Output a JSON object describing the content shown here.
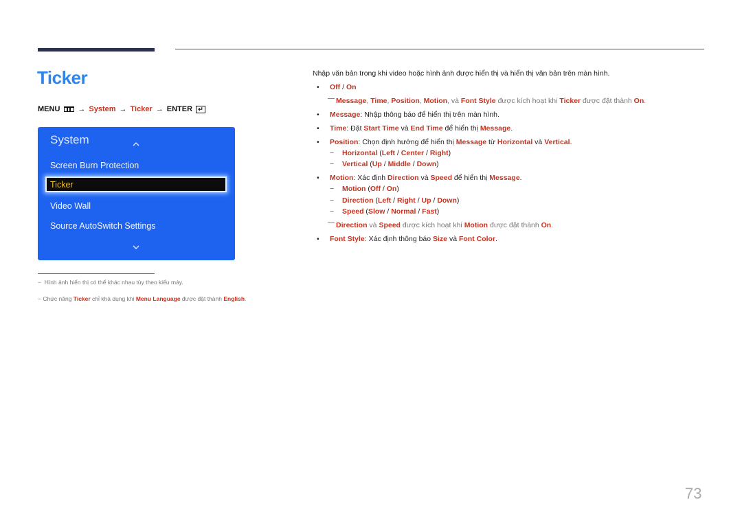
{
  "header": {
    "title": "Ticker",
    "menu_path": {
      "menu_label": "MENU",
      "step1": "System",
      "step2": "Ticker",
      "enter_label": "ENTER",
      "arrow": "→"
    }
  },
  "osd_panel": {
    "title": "System",
    "items": [
      {
        "label": "Screen Burn Protection",
        "selected": false
      },
      {
        "label": "Ticker",
        "selected": true
      },
      {
        "label": "Video Wall",
        "selected": false
      },
      {
        "label": "Source AutoSwitch Settings",
        "selected": false
      }
    ]
  },
  "footnotes": [
    {
      "text": "Hình ảnh hiển thị có thể khác nhau tùy theo kiểu máy."
    },
    {
      "pre": "Chức năng ",
      "k1": "Ticker",
      "mid": " chỉ khả dụng khi ",
      "k2": "Menu Language",
      "mid2": " được đặt thành ",
      "k3": "English",
      "end": "."
    }
  ],
  "content": {
    "intro": "Nhập văn bản trong khi video hoặc hình ảnh được hiển thị và hiển thị văn bản trên màn hình.",
    "off_on": {
      "off": "Off",
      "sep": " / ",
      "on": "On"
    },
    "note1": {
      "k1": "Message",
      "c1": ", ",
      "k2": "Time",
      "c2": ", ",
      "k3": "Position",
      "c3": ", ",
      "k4": "Motion",
      "c4": ", và ",
      "k5": "Font Style",
      "t1": " được kích hoạt khi ",
      "k6": "Ticker",
      "t2": " được đặt thành ",
      "k7": "On",
      "end": "."
    },
    "message": {
      "key": "Message",
      "text": ": Nhập thông báo để hiển thị trên màn hình."
    },
    "time": {
      "key": "Time",
      "t1": ": Đặt ",
      "k1": "Start Time",
      "t2": " và ",
      "k2": "End Time",
      "t3": " để hiển thị ",
      "k3": "Message",
      "end": "."
    },
    "position": {
      "key": "Position",
      "t1": ": Chọn định hướng để hiển thị ",
      "k1": "Message",
      "t2": " từ ",
      "k2": "Horizontal",
      "t3": " và ",
      "k3": "Vertical",
      "end": "."
    },
    "horizontal": {
      "key": "Horizontal",
      "o1": "Left",
      "o2": "Center",
      "o3": "Right"
    },
    "vertical": {
      "key": "Vertical",
      "o1": "Up",
      "o2": "Middle",
      "o3": "Down"
    },
    "motion": {
      "key": "Motion",
      "t1": ": Xác định ",
      "k1": "Direction",
      "t2": " và ",
      "k2": "Speed",
      "t3": " để hiển thị ",
      "k3": "Message",
      "end": "."
    },
    "motion_sub": {
      "key": "Motion",
      "o1": "Off",
      "o2": "On"
    },
    "direction_sub": {
      "key": "Direction",
      "o1": "Left",
      "o2": "Right",
      "o3": "Up",
      "o4": "Down"
    },
    "speed_sub": {
      "key": "Speed",
      "o1": "Slow",
      "o2": "Normal",
      "o3": "Fast"
    },
    "note2": {
      "k1": "Direction",
      "t1": " và ",
      "k2": "Speed",
      "t2": " được kích hoạt khi ",
      "k3": "Motion",
      "t3": " được đặt thành ",
      "k4": "On",
      "end": "."
    },
    "font_style": {
      "key": "Font Style",
      "t1": ": Xác định thông báo ",
      "k1": "Size",
      "t2": " và ",
      "k2": "Font Color",
      "end": "."
    }
  },
  "page_number": "73"
}
